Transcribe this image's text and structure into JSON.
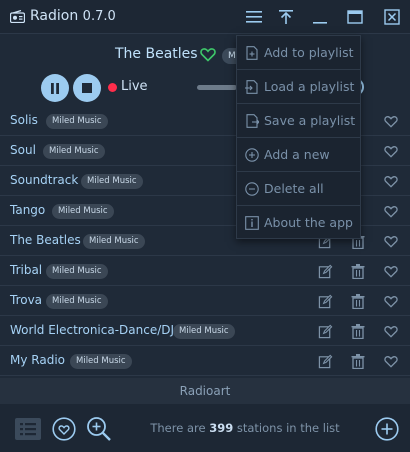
{
  "app": {
    "name": "Radion",
    "version": "0.7.0"
  },
  "player": {
    "station": "The Beatles",
    "genre_tag": "Mi",
    "live_label": "Live"
  },
  "stations": [
    {
      "name": "Solis",
      "tag": "Miled Music"
    },
    {
      "name": "Soul",
      "tag": "Miled Music"
    },
    {
      "name": "Soundtrack",
      "tag": "Miled Music"
    },
    {
      "name": "Tango",
      "tag": "Miled Music"
    },
    {
      "name": "The Beatles",
      "tag": "Miled Music"
    },
    {
      "name": "Tribal",
      "tag": "Miled Music"
    },
    {
      "name": "Trova",
      "tag": "Miled Music"
    },
    {
      "name": "World Electronica-Dance/DJ",
      "tag": "Miled Music"
    },
    {
      "name": "My Radio",
      "tag": "Miled Music"
    }
  ],
  "footer": {
    "title": "Radioart"
  },
  "status": {
    "prefix": "There are",
    "count": "399",
    "suffix": "stations in the list"
  },
  "menu": {
    "items": [
      {
        "label": "Add to playlist",
        "icon": "add-file-icon"
      },
      {
        "label": "Load a playlist",
        "icon": "load-file-icon"
      },
      {
        "label": "Save a playlist",
        "icon": "save-file-icon"
      },
      {
        "label": "Add a new",
        "icon": "plus-circle-icon"
      },
      {
        "label": "Delete all",
        "icon": "minus-circle-icon"
      },
      {
        "label": "About the app",
        "icon": "info-icon"
      }
    ]
  },
  "colors": {
    "accent": "#9ccbf0",
    "live": "#ff2d4b",
    "favorite": "#3ec86a",
    "background": "#1f2a38"
  }
}
